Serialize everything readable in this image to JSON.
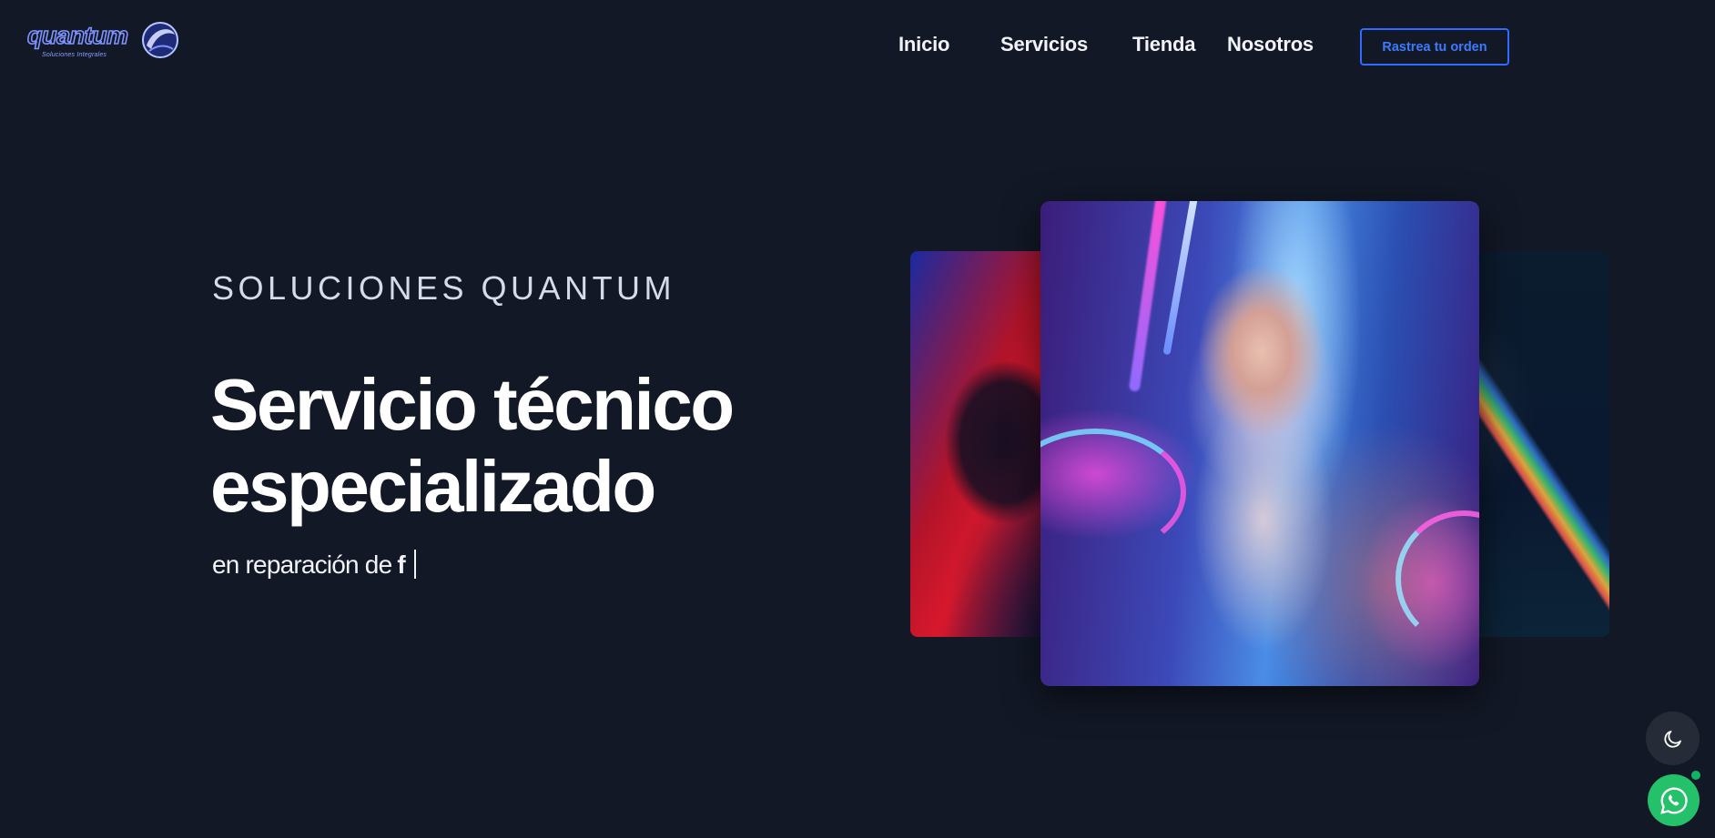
{
  "header": {
    "logo": {
      "text": "quantum",
      "tagline": "Soluciones Integrales"
    },
    "nav": [
      {
        "label": "Inicio"
      },
      {
        "label": "Servicios"
      },
      {
        "label": "Tienda"
      },
      {
        "label": "Nosotros"
      }
    ],
    "track_button": "Rastrea tu orden"
  },
  "hero": {
    "eyebrow": "SOLUCIONES QUANTUM",
    "headline_line1": "Servicio técnico",
    "headline_line2": "especializado",
    "subline_prefix": "en reparación de",
    "subline_typed": "f"
  },
  "floating": {
    "theme_toggle_icon": "moon-icon",
    "whatsapp_icon": "whatsapp-icon"
  },
  "colors": {
    "background": "#121826",
    "accent": "#2f6bff",
    "whatsapp": "#25c06a"
  }
}
